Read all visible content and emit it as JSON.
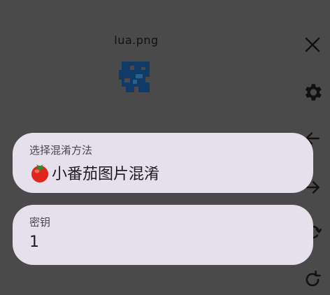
{
  "image": {
    "filename": "lua.png"
  },
  "toolbar": {
    "icons": [
      "close-icon",
      "gear-icon",
      "arrow-left-icon",
      "arrow-right-icon",
      "rotate-icon",
      "refresh-icon"
    ]
  },
  "method_field": {
    "label": "选择混淆方法",
    "icon": "tomato-emoji",
    "value": "小番茄图片混淆"
  },
  "key_field": {
    "label": "密钥",
    "value": "1"
  },
  "colors": {
    "background": "#4a4a4a",
    "card": "#e6dfec",
    "preview": "#0f3b66"
  }
}
